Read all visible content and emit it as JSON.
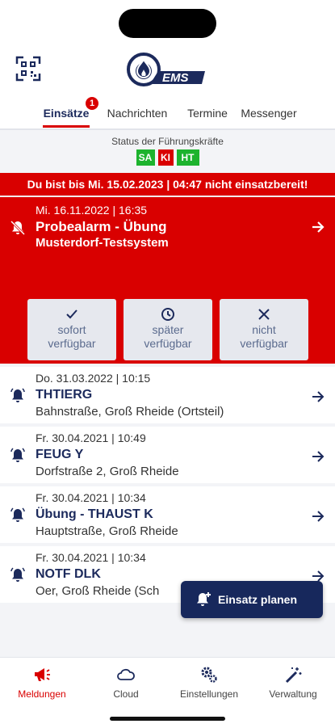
{
  "header": {
    "logo_text": "EMS",
    "tabs": [
      {
        "label": "Einsätze",
        "badge": "1",
        "active": true
      },
      {
        "label": "Nachrichten"
      },
      {
        "label": "Termine"
      },
      {
        "label": "Messenger"
      }
    ]
  },
  "status": {
    "title": "Status der Führungskräfte",
    "badges": [
      {
        "label": "SA",
        "color": "#1db32e"
      },
      {
        "label": "KI",
        "color": "#d90000"
      },
      {
        "label": "HT",
        "color": "#1db32e"
      }
    ]
  },
  "banner": {
    "text": "Du bist bis Mi. 15.02.2023 | 04:47 nicht einsatzbereit!"
  },
  "alarm": {
    "date": "Mi. 16.11.2022 | 16:35",
    "title": "Probealarm - Übung",
    "subtitle": "Musterdorf-Testsystem",
    "buttons": [
      {
        "icon": "check-icon",
        "line1": "sofort",
        "line2": "verfügbar"
      },
      {
        "icon": "clock-icon",
        "line1": "später",
        "line2": "verfügbar"
      },
      {
        "icon": "x-icon",
        "line1": "nicht",
        "line2": "verfügbar"
      }
    ]
  },
  "items": [
    {
      "date": "Do. 31.03.2022 | 10:15",
      "title": "THTIERG",
      "subtitle": "Bahnstraße, Groß Rheide (Ortsteil)"
    },
    {
      "date": "Fr. 30.04.2021 | 10:49",
      "title": "FEUG Y",
      "subtitle": "Dorfstraße 2, Groß Rheide"
    },
    {
      "date": "Fr. 30.04.2021 | 10:34",
      "title": "Übung - THAUST K",
      "subtitle": "Hauptstraße, Groß Rheide"
    },
    {
      "date": "Fr. 30.04.2021 | 10:34",
      "title": "NOTF DLK",
      "subtitle": "Oer, Groß Rheide (Sch"
    }
  ],
  "fab": {
    "label": "Einsatz planen"
  },
  "bottom_nav": [
    {
      "label": "Meldungen",
      "icon": "megaphone-icon",
      "active": true
    },
    {
      "label": "Cloud",
      "icon": "cloud-icon"
    },
    {
      "label": "Einstellungen",
      "icon": "gears-icon"
    },
    {
      "label": "Verwaltung",
      "icon": "wand-icon"
    }
  ],
  "colors": {
    "accent": "#d90000",
    "navy": "#1c2a5c",
    "green": "#1db32e"
  }
}
